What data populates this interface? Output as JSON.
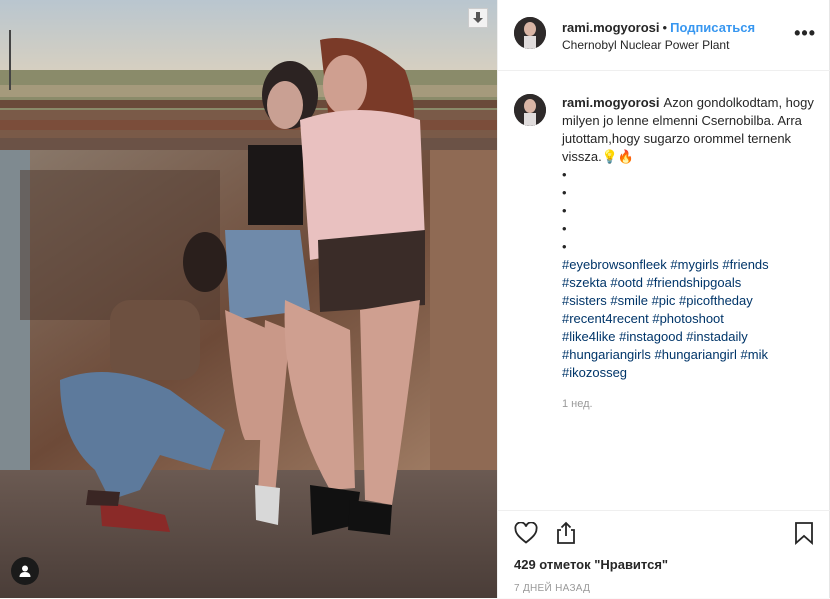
{
  "post": {
    "username": "rami.mogyorosi",
    "follow_label": "Подписаться",
    "separator": "•",
    "location": "Chernobyl Nuclear Power Plant",
    "more_label": "•••"
  },
  "caption": {
    "username": "rami.mogyorosi",
    "text": "Azon gondolkodtam, hogy milyen jo lenne elmenni Csernobilba. Arra jutottam,hogy sugarzo orommel ternenk vissza.💡🔥",
    "bullets": [
      "•",
      "•",
      "•",
      "•",
      "•"
    ],
    "hashtag_lines": [
      "#eyebrowsonfleek #mygirls #friends",
      "#szekta #ootd #friendshipgoals",
      "#sisters #smile #pic #picoftheday",
      "#recent4recent #photoshoot",
      "#like4like #instagood #instadaily",
      "#hungariangirls #hungariangirl #mik",
      "#ikozosseg"
    ],
    "time_ago": "1 нед."
  },
  "footer": {
    "likes": "429 отметок \"Нравится\"",
    "date": "7 ДНЕЙ НАЗАД"
  },
  "icons": {
    "download": "download-icon",
    "user_tag": "user-tag-icon",
    "like": "heart-icon",
    "share": "share-icon",
    "save": "bookmark-icon"
  },
  "colors": {
    "link": "#3897f0",
    "hashtag": "#003569",
    "text": "#262626",
    "muted": "#999999"
  }
}
